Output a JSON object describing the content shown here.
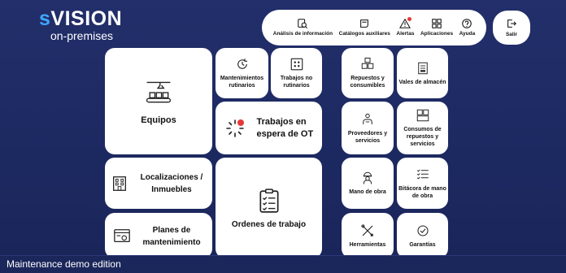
{
  "logo": {
    "brand_s": "s",
    "brand_rest": "VISION",
    "sub": "on-premises"
  },
  "topbar": {
    "items": [
      {
        "label": "Análisis de información",
        "icon": "analysis-icon"
      },
      {
        "label": "Catálogos auxiliares",
        "icon": "catalog-icon"
      },
      {
        "label": "Alertas",
        "icon": "alert-icon"
      },
      {
        "label": "Aplicaciones",
        "icon": "apps-icon"
      },
      {
        "label": "Ayuda",
        "icon": "help-icon"
      }
    ],
    "exit_label": "Salir"
  },
  "tiles": {
    "equipos": "Equipos",
    "mantenimientos": "Mantenimientos rutinarios",
    "trabajos_no": "Trabajos no rutinarios",
    "espera": "Trabajos en espera de OT",
    "localizaciones": "Localizaciones / Inmuebles",
    "ordenes": "Ordenes de trabajo",
    "planes": "Planes de mantenimiento",
    "repuestos": "Repuestos y consumibles",
    "vales": "Vales de almacén",
    "proveedores": "Proveedores y servicios",
    "consumos": "Consumos de repuestos y servicios",
    "mano_obra": "Mano de obra",
    "bitacora": "Bitácora de mano de obra",
    "herramientas": "Herramientas",
    "garantias": "Garantías"
  },
  "footer": {
    "text": "Maintenance demo edition"
  },
  "colors": {
    "background": "#1d2a63",
    "accent": "#3ea7ff",
    "alert": "#e53935"
  }
}
